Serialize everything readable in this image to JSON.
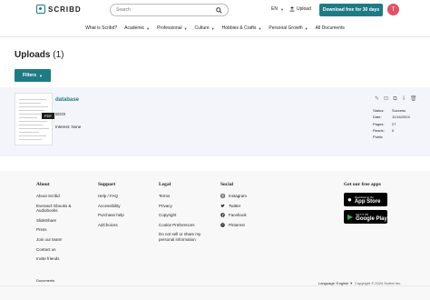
{
  "header": {
    "logo_text": "SCRIBD",
    "search_placeholder": "Search",
    "language": "EN",
    "upload_label": "Upload",
    "cta_label": "Download free for 30 days",
    "avatar_initial": "T",
    "brand_color": "#1e7b85",
    "avatar_color": "#e05264"
  },
  "nav": {
    "items": [
      {
        "label": "What is Scribd?",
        "dropdown": false
      },
      {
        "label": "Academic",
        "dropdown": true
      },
      {
        "label": "Professional",
        "dropdown": true
      },
      {
        "label": "Culture",
        "dropdown": true
      },
      {
        "label": "Hobbies & Crafts",
        "dropdown": true
      },
      {
        "label": "Personal Growth",
        "dropdown": true
      },
      {
        "label": "All Documents",
        "dropdown": false
      }
    ]
  },
  "page": {
    "title": "Uploads",
    "count": "(1)",
    "filters_label": "Filters"
  },
  "upload": {
    "title": "database",
    "badge": "PDF",
    "author": "BOOI",
    "interest": "Interest: None",
    "stats": [
      {
        "label": "Status:",
        "value": "Success"
      },
      {
        "label": "Date:",
        "value": "11/16/2024"
      },
      {
        "label": "Pages:",
        "value": "27"
      },
      {
        "label": "Reads:",
        "value": "0"
      },
      {
        "label": "Public",
        "value": ""
      }
    ],
    "action_icons": [
      "edit-icon",
      "bookmark-icon",
      "embed-icon",
      "download-icon",
      "delete-icon"
    ]
  },
  "footer": {
    "about": {
      "heading": "About",
      "links": [
        "About Scribd",
        "Everand: Ebooks & Audiobooks",
        "SlideShare",
        "Press",
        "Join our team!",
        "Contact us",
        "Invite friends"
      ]
    },
    "support": {
      "heading": "Support",
      "links": [
        "Help / FAQ",
        "Accessibility",
        "Purchase help",
        "AdChoices"
      ]
    },
    "legal": {
      "heading": "Legal",
      "links": [
        "Terms",
        "Privacy",
        "Copyright",
        "Cookie Preferences",
        "Do not sell or share my personal information"
      ]
    },
    "social": {
      "heading": "Social",
      "links": [
        {
          "label": "Instagram",
          "icon": "instagram-icon"
        },
        {
          "label": "Twitter",
          "icon": "twitter-icon"
        },
        {
          "label": "Facebook",
          "icon": "facebook-icon"
        },
        {
          "label": "Pinterest",
          "icon": "pinterest-icon"
        }
      ]
    },
    "apps": {
      "heading": "Get our free apps",
      "app_store": {
        "sub": "Download on the",
        "main": "App Store"
      },
      "google_play": {
        "sub": "GET IT ON",
        "main": "Google Play"
      }
    },
    "documents_label": "Documents",
    "language": "Language: English",
    "copyright": "Copyright © 2024 Scribd Inc."
  }
}
